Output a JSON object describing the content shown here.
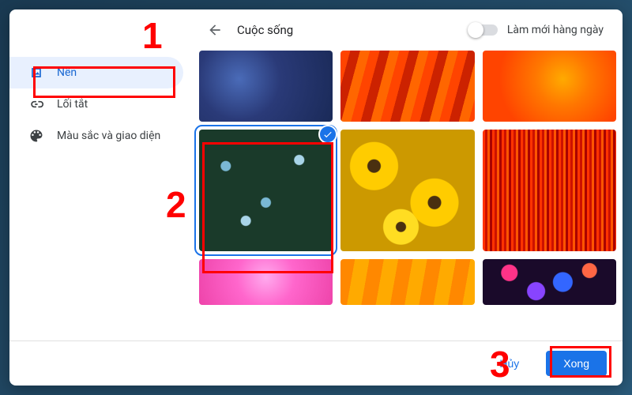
{
  "header": {
    "title": "Cuộc sống",
    "refresh_label": "Làm mới hàng ngày",
    "refresh_enabled": false
  },
  "sidebar": {
    "items": [
      {
        "id": "background",
        "label": "Nền",
        "icon": "image-icon",
        "active": true
      },
      {
        "id": "shortcuts",
        "label": "Lối tắt",
        "icon": "link-icon",
        "active": false
      },
      {
        "id": "theme",
        "label": "Màu sắc và giao diện",
        "icon": "palette-icon",
        "active": false
      }
    ]
  },
  "gallery": {
    "selected_index": 3,
    "thumbnails": [
      {
        "id": 0,
        "name": "blue-crystal"
      },
      {
        "id": 1,
        "name": "orange-stripes"
      },
      {
        "id": 2,
        "name": "orange-flower-macro"
      },
      {
        "id": 3,
        "name": "forget-me-not-flowers",
        "selected": true
      },
      {
        "id": 4,
        "name": "yellow-sunflowers"
      },
      {
        "id": 5,
        "name": "red-curtain"
      },
      {
        "id": 6,
        "name": "pink-dahlia"
      },
      {
        "id": 7,
        "name": "orange-diagonal"
      },
      {
        "id": 8,
        "name": "bokeh-lights"
      }
    ]
  },
  "footer": {
    "cancel_label": "Hủy",
    "done_label": "Xong"
  },
  "annotations": {
    "n1": "1",
    "n2": "2",
    "n3": "3"
  }
}
